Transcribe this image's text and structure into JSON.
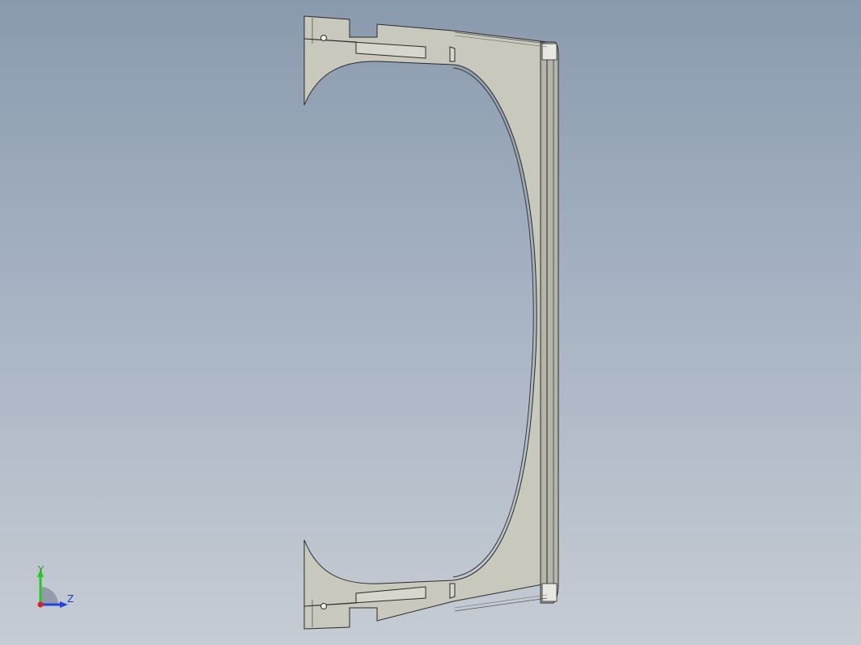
{
  "viewport": {
    "background_top": "#8a9aae",
    "background_bottom": "#c6ccd4"
  },
  "model": {
    "part_color": "#c8c8bd",
    "edge_color": "#2a2a2a",
    "rim_color": "#b4b4a8"
  },
  "triad": {
    "y_label": "Y",
    "z_label": "Z",
    "y_color": "#22cc22",
    "z_color": "#2244dd",
    "x_color": "#dd2222"
  }
}
